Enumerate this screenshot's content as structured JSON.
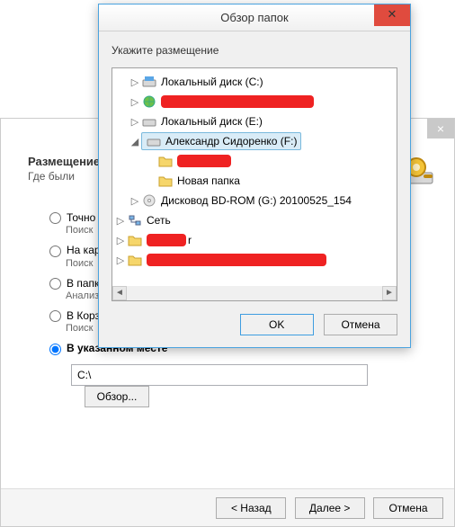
{
  "wizard": {
    "heading": "Размещение",
    "sub": "Где были",
    "options": {
      "exact": {
        "label": "Точно",
        "desc": "Поиск"
      },
      "card": {
        "label": "На кар",
        "desc": "Поиск"
      },
      "folder": {
        "label": "В папк",
        "desc": "Анализ"
      },
      "recycle": {
        "label": "В Корз",
        "desc": "Поиск"
      },
      "specified": {
        "label": "В указанном месте"
      }
    },
    "path_value": "C:\\",
    "browse": "Обзор...",
    "back": "< Назад",
    "next": "Далее >",
    "cancel": "Отмена"
  },
  "dlg": {
    "title": "Обзор папок",
    "instruction": "Укажите размещение",
    "ok": "OK",
    "cancel": "Отмена",
    "tree": {
      "local_c": "Локальный диск (C:)",
      "local_e": "Локальный диск (E:)",
      "selected": "Александр Сидоренко (F:)",
      "new_folder": "Новая папка",
      "bdrom": "Дисковод BD-ROM (G:) 20100525_154",
      "network": "Сеть",
      "redacted_tail": "r"
    }
  }
}
